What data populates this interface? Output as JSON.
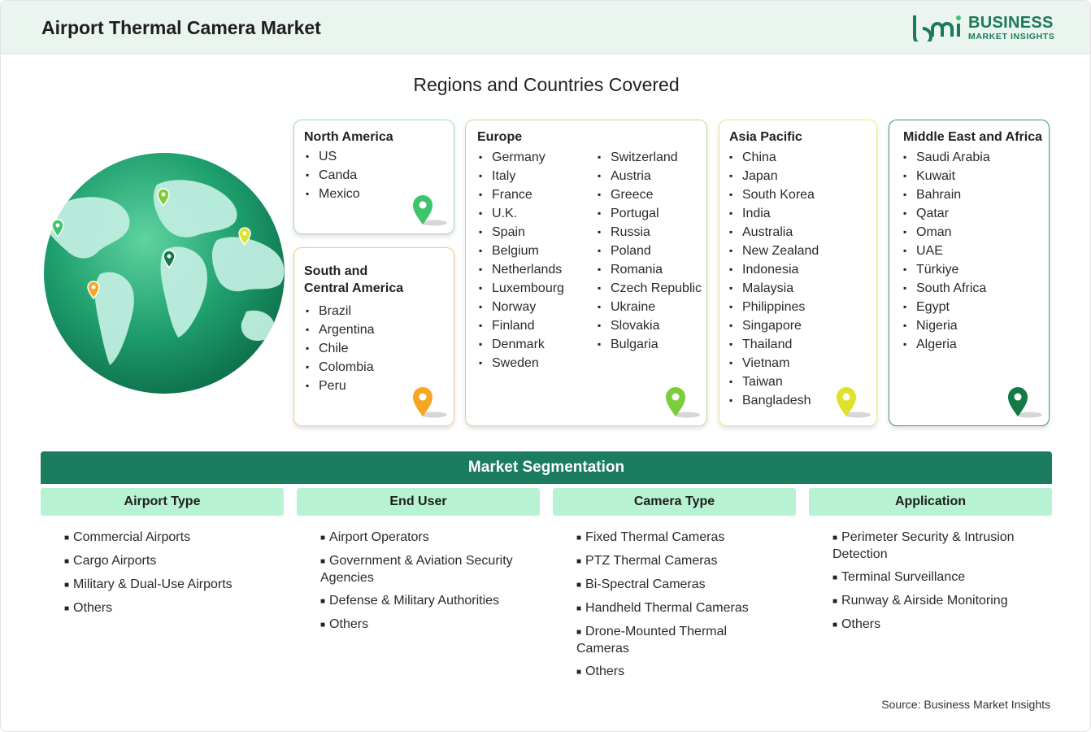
{
  "header": {
    "title": "Airport Thermal Camera Market",
    "logo_line1": "BUSINESS",
    "logo_line2": "MARKET INSIGHTS"
  },
  "regions_title": "Regions and Countries Covered",
  "regions": {
    "north_america": {
      "title": "North America",
      "pin_color": "#3ec46d",
      "countries": [
        "US",
        "Canda",
        "Mexico"
      ]
    },
    "south_central_america": {
      "title_line1": "South and",
      "title_line2": "Central America",
      "pin_color": "#f5a623",
      "countries": [
        "Brazil",
        "Argentina",
        "Chile",
        "Colombia",
        "Peru"
      ]
    },
    "europe": {
      "title": "Europe",
      "pin_color": "#7ccd3c",
      "countries_col1": [
        "Germany",
        "Italy",
        "France",
        "U.K.",
        "Spain",
        "Belgium",
        "Netherlands",
        "Luxembourg",
        "Norway",
        "Finland",
        "Denmark",
        "Sweden"
      ],
      "countries_col2": [
        "Switzerland",
        "Austria",
        "Greece",
        "Portugal",
        "Russia",
        "Poland",
        "Romania",
        "Czech Republic",
        "Ukraine",
        "Slovakia",
        "Bulgaria"
      ]
    },
    "asia_pacific": {
      "title": "Asia Pacific",
      "pin_color": "#dfe22a",
      "countries": [
        "China",
        "Japan",
        "South Korea",
        "India",
        "Australia",
        "New Zealand",
        "Indonesia",
        "Malaysia",
        "Philippines",
        "Singapore",
        "Thailand",
        "Vietnam",
        "Taiwan",
        "Bangladesh"
      ]
    },
    "middle_east_africa": {
      "title": "Middle East and Africa",
      "pin_color": "#137a45",
      "countries": [
        "Saudi Arabia",
        "Kuwait",
        "Bahrain",
        "Qatar",
        "Oman",
        "UAE",
        "Türkiye",
        "South Africa",
        "Egypt",
        "Nigeria",
        "Algeria"
      ]
    }
  },
  "segmentation": {
    "title": "Market Segmentation",
    "columns": [
      {
        "heading": "Airport Type",
        "items": [
          "Commercial Airports",
          "Cargo Airports",
          "Military & Dual-Use Airports",
          "Others"
        ]
      },
      {
        "heading": "End User",
        "items": [
          "Airport Operators",
          "Government & Aviation Security Agencies",
          "Defense & Military Authorities",
          "Others"
        ]
      },
      {
        "heading": "Camera Type",
        "items": [
          "Fixed Thermal Cameras",
          "PTZ Thermal Cameras",
          "Bi-Spectral Cameras",
          "Handheld Thermal Cameras",
          "Drone-Mounted Thermal Cameras",
          "Others"
        ]
      },
      {
        "heading": "Application",
        "items": [
          "Perimeter Security & Intrusion Detection",
          "Terminal Surveillance",
          "Runway & Airside Monitoring",
          "Others"
        ]
      }
    ]
  },
  "source": "Source: Business Market Insights",
  "colors": {
    "brand_green": "#1b7c5f",
    "segment_header_bg": "#b7f2d3",
    "header_bg": "#e9f5ee"
  }
}
